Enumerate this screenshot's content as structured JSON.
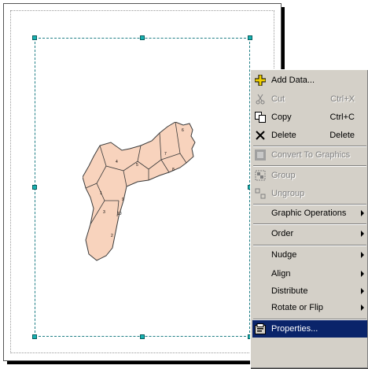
{
  "colors": {
    "selection": "#0a246a",
    "menu_bg": "#d4d0c8",
    "map_fill": "#f8d3bd",
    "handle": "#17b2b2"
  },
  "map": {
    "labels": [
      "6",
      "4",
      "5",
      "7",
      "8",
      "1",
      "3",
      "9",
      "10",
      "2"
    ]
  },
  "context_menu": {
    "items": [
      {
        "label": "Add Data...",
        "shortcut": "",
        "icon": "add-data-icon",
        "enabled": true,
        "submenu": false
      },
      {
        "label": "Cut",
        "shortcut": "Ctrl+X",
        "icon": "scissors-icon",
        "enabled": false,
        "submenu": false
      },
      {
        "label": "Copy",
        "shortcut": "Ctrl+C",
        "icon": "copy-icon",
        "enabled": true,
        "submenu": false
      },
      {
        "label": "Delete",
        "shortcut": "Delete",
        "icon": "delete-x-icon",
        "enabled": true,
        "submenu": false
      },
      {
        "label": "Convert To Graphics",
        "shortcut": "",
        "icon": "convert-graphics-icon",
        "enabled": false,
        "submenu": false
      },
      {
        "label": "Group",
        "shortcut": "",
        "icon": "group-icon",
        "enabled": false,
        "submenu": false
      },
      {
        "label": "Ungroup",
        "shortcut": "",
        "icon": "ungroup-icon",
        "enabled": false,
        "submenu": false
      },
      {
        "label": "Graphic Operations",
        "shortcut": "",
        "icon": "",
        "enabled": true,
        "submenu": true
      },
      {
        "label": "Order",
        "shortcut": "",
        "icon": "",
        "enabled": true,
        "submenu": true
      },
      {
        "label": "Nudge",
        "shortcut": "",
        "icon": "",
        "enabled": true,
        "submenu": true
      },
      {
        "label": "Align",
        "shortcut": "",
        "icon": "",
        "enabled": true,
        "submenu": true
      },
      {
        "label": "Distribute",
        "shortcut": "",
        "icon": "",
        "enabled": true,
        "submenu": true
      },
      {
        "label": "Rotate or Flip",
        "shortcut": "",
        "icon": "",
        "enabled": true,
        "submenu": true
      },
      {
        "label": "Properties...",
        "shortcut": "",
        "icon": "properties-icon",
        "enabled": true,
        "submenu": false,
        "selected": true
      }
    ]
  }
}
